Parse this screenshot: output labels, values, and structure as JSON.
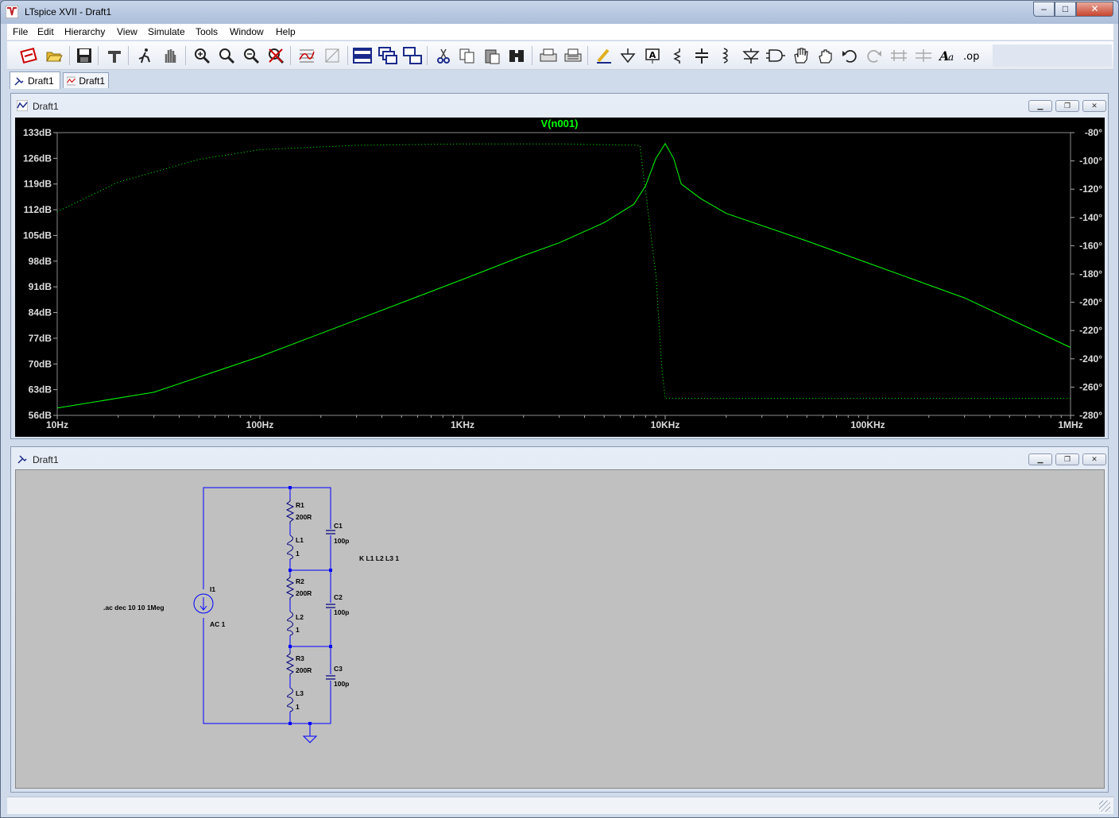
{
  "window": {
    "title": "LTspice XVII - Draft1",
    "min_label": "‒",
    "max_label": "□",
    "close_label": "✕"
  },
  "menu": [
    "File",
    "Edit",
    "Hierarchy",
    "View",
    "Simulate",
    "Tools",
    "Window",
    "Help"
  ],
  "toolbar_icons": [
    "new-schematic-icon",
    "open-icon",
    "save-icon",
    "control-panel-icon",
    "run-icon",
    "halt-icon",
    "zoom-in-icon",
    "pan-icon",
    "zoom-out-icon",
    "zoom-fit-icon",
    "autorange-icon",
    "grid-icon",
    "tile-horizontal-icon",
    "cascade-icon",
    "tile-vertical-icon",
    "cut-icon",
    "copy-icon",
    "paste-icon",
    "find-icon",
    "print-icon",
    "print-setup-icon",
    "draw-wire-icon",
    "ground-icon",
    "label-net-icon",
    "resistor-icon",
    "capacitor-icon",
    "inductor-icon",
    "diode-icon",
    "component-icon",
    "move-icon",
    "drag-icon",
    "undo-icon",
    "redo-icon",
    "rotate-icon",
    "mirror-icon",
    "text-icon",
    "spice-directive-icon"
  ],
  "tabs": [
    {
      "label": "Draft1",
      "kind": "schematic"
    },
    {
      "label": "Draft1",
      "kind": "waveform"
    }
  ],
  "waveform_window": {
    "title": "Draft1"
  },
  "schematic_window": {
    "title": "Draft1"
  },
  "chart_data": {
    "type": "line",
    "title": "V(n001)",
    "xscale": "log",
    "x_range": [
      10,
      1000000
    ],
    "x_ticks": [
      "10Hz",
      "100Hz",
      "1KHz",
      "10KHz",
      "100KHz",
      "1MHz"
    ],
    "y_left_ticks": [
      "133dB",
      "126dB",
      "119dB",
      "112dB",
      "105dB",
      "98dB",
      "91dB",
      "84dB",
      "77dB",
      "70dB",
      "63dB",
      "56dB"
    ],
    "y_left_range": [
      56,
      133
    ],
    "y_right_ticks": [
      "-80°",
      "-100°",
      "-120°",
      "-140°",
      "-160°",
      "-180°",
      "-200°",
      "-220°",
      "-240°",
      "-260°",
      "-280°"
    ],
    "y_right_range": [
      -280,
      -80
    ],
    "series": [
      {
        "name": "V(n001)",
        "kind": "magnitude",
        "color": "#00ff00",
        "points": [
          [
            10,
            58
          ],
          [
            30,
            62.3
          ],
          [
            100,
            72
          ],
          [
            300,
            82
          ],
          [
            1000,
            93
          ],
          [
            2000,
            99.5
          ],
          [
            3000,
            103
          ],
          [
            5000,
            108.5
          ],
          [
            7000,
            113.5
          ],
          [
            8000,
            118.5
          ],
          [
            9000,
            126
          ],
          [
            10000,
            130
          ],
          [
            11000,
            126
          ],
          [
            12000,
            119
          ],
          [
            15000,
            115
          ],
          [
            20000,
            111
          ],
          [
            50000,
            103.5
          ],
          [
            100000,
            97.5
          ],
          [
            300000,
            88
          ],
          [
            1000000,
            74.5
          ]
        ]
      },
      {
        "name": "V(n001) phase",
        "kind": "phase",
        "color": "#00ff00",
        "points": [
          [
            10,
            -136
          ],
          [
            20,
            -115
          ],
          [
            50,
            -99
          ],
          [
            100,
            -92
          ],
          [
            300,
            -89
          ],
          [
            1000,
            -88
          ],
          [
            3000,
            -88
          ],
          [
            7500,
            -89
          ],
          [
            8300,
            -140
          ],
          [
            8800,
            -170
          ],
          [
            9000,
            -180
          ],
          [
            9600,
            -245
          ],
          [
            10000,
            -268
          ],
          [
            12000,
            -268
          ],
          [
            100000,
            -268
          ],
          [
            1000000,
            -268
          ]
        ]
      }
    ]
  },
  "schematic": {
    "directive_ac": ".ac dec 10 10 1Meg",
    "directive_k": "K L1 L2 L3 1",
    "source_name": "I1",
    "source_value": "AC 1",
    "R1": "R1",
    "R1_val": "200R",
    "R2": "R2",
    "R2_val": "200R",
    "R3": "R3",
    "R3_val": "200R",
    "L1": "L1",
    "L1_val": "1",
    "L2": "L2",
    "L2_val": "1",
    "L3": "L3",
    "L3_val": "1",
    "C1": "C1",
    "C1_val": "100p",
    "C2": "C2",
    "C2_val": "100p",
    "C3": "C3",
    "C3_val": "100p",
    "wire_color": "#0000ff"
  }
}
